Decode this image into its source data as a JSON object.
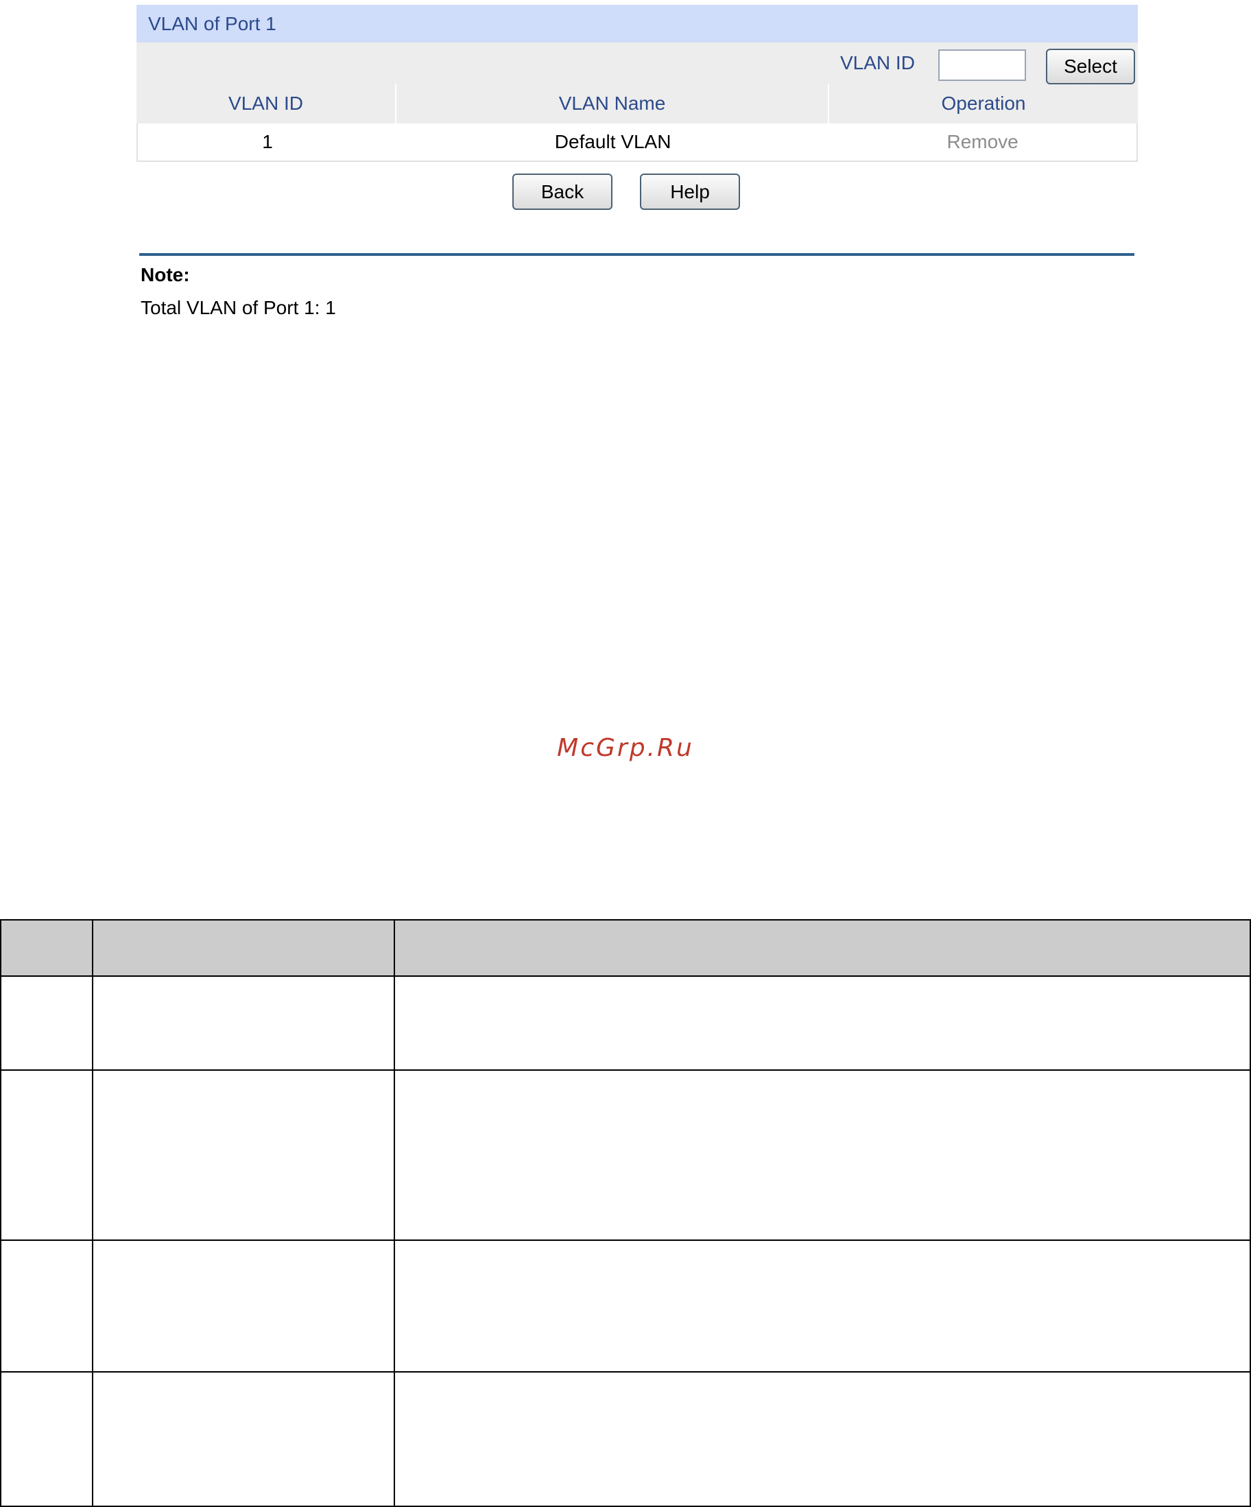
{
  "panel": {
    "title": "VLAN of Port 1",
    "filter": {
      "label": "VLAN ID",
      "input_value": "",
      "select_label": "Select"
    },
    "columns": [
      "VLAN ID",
      "VLAN Name",
      "Operation"
    ],
    "rows": [
      {
        "vlan_id": "1",
        "vlan_name": "Default VLAN",
        "operation": "Remove"
      }
    ]
  },
  "buttons": {
    "back": "Back",
    "help": "Help"
  },
  "note": {
    "title": "Note:",
    "text": "Total VLAN of Port 1: 1"
  },
  "watermark": "McGrp.Ru",
  "colors": {
    "title_bar": "#cfdcfa",
    "title_text": "#2b4a8a",
    "header_bg": "#ededed",
    "rule": "#2f5f8f",
    "disabled_link": "#8c8c8c",
    "watermark": "#c0392b",
    "doc_header_bg": "#cccccc"
  }
}
